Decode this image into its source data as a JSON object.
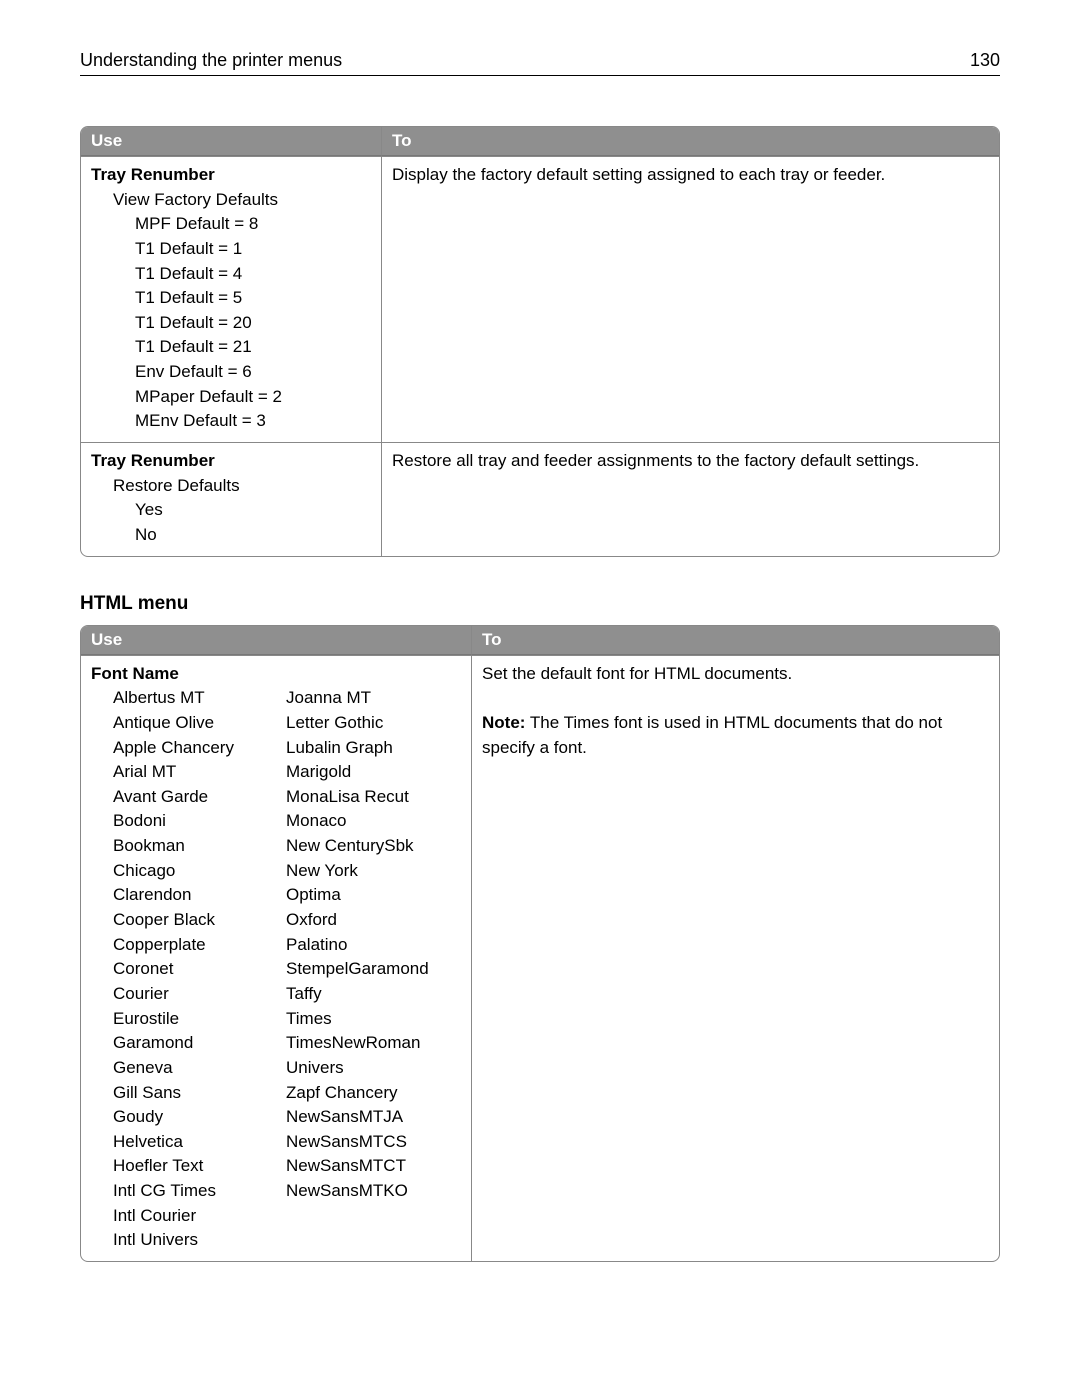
{
  "header": {
    "title": "Understanding the printer menus",
    "page_number": "130"
  },
  "table1": {
    "headers": {
      "use": "Use",
      "to": "To"
    },
    "row1": {
      "title": "Tray Renumber",
      "sub": "View Factory Defaults",
      "items": [
        "MPF Default = 8",
        "T1 Default = 1",
        "T1 Default = 4",
        "T1 Default = 5",
        "T1 Default = 20",
        "T1 Default = 21",
        "Env Default = 6",
        "MPaper Default = 2",
        "MEnv Default = 3"
      ],
      "to": "Display the factory default setting assigned to each tray or feeder."
    },
    "row2": {
      "title": "Tray Renumber",
      "sub": "Restore Defaults",
      "items": [
        "Yes",
        "No"
      ],
      "to": "Restore all tray and feeder assignments to the factory default settings."
    }
  },
  "section2_title": "HTML menu",
  "table2": {
    "headers": {
      "use": "Use",
      "to": "To"
    },
    "row1": {
      "title": "Font Name",
      "colA": [
        "Albertus MT",
        "Antique Olive",
        "Apple Chancery",
        "Arial MT",
        "Avant Garde",
        "Bodoni",
        "Bookman",
        "Chicago",
        "Clarendon",
        "Cooper Black",
        "Copperplate",
        "Coronet",
        "Courier",
        "Eurostile",
        "Garamond",
        "Geneva",
        "Gill Sans",
        "Goudy",
        "Helvetica",
        "Hoefler Text",
        "Intl CG Times",
        "Intl Courier",
        "Intl Univers"
      ],
      "colB": [
        "Joanna MT",
        "Letter Gothic",
        "Lubalin Graph",
        "Marigold",
        "MonaLisa Recut",
        "Monaco",
        "New CenturySbk",
        "New York",
        "Optima",
        "Oxford",
        "Palatino",
        "StempelGaramond",
        "Taffy",
        "Times",
        "TimesNewRoman",
        "Univers",
        "Zapf Chancery",
        "NewSansMTJA",
        "NewSansMTCS",
        "NewSansMTCT",
        "NewSansMTKO"
      ],
      "to": "Set the default font for HTML documents.",
      "note_label": "Note:",
      "note_text": " The Times font is used in HTML documents that do not specify a font."
    }
  }
}
